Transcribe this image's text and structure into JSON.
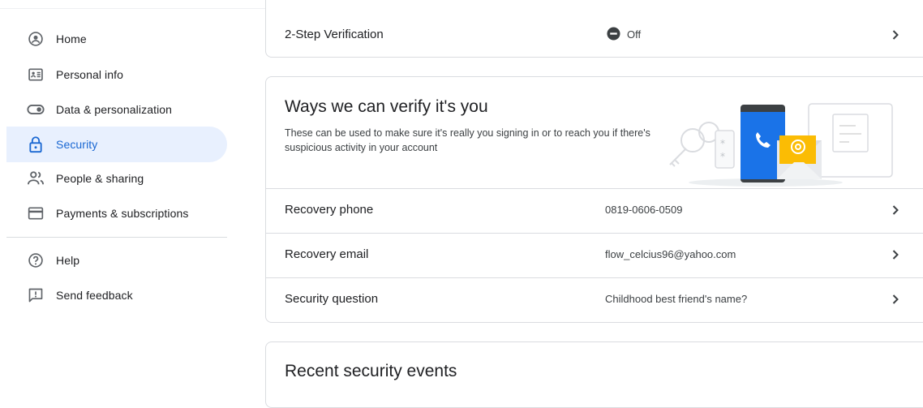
{
  "sidebar": {
    "items": [
      {
        "label": "Home",
        "icon": "account-circle-icon"
      },
      {
        "label": "Personal info",
        "icon": "id-card-icon"
      },
      {
        "label": "Data & personalization",
        "icon": "toggle-icon"
      },
      {
        "label": "Security",
        "icon": "lock-icon",
        "active": true
      },
      {
        "label": "People & sharing",
        "icon": "people-icon"
      },
      {
        "label": "Payments & subscriptions",
        "icon": "credit-card-icon"
      },
      {
        "label": "Help",
        "icon": "help-icon"
      },
      {
        "label": "Send feedback",
        "icon": "feedback-icon"
      }
    ]
  },
  "two_step": {
    "label": "2-Step Verification",
    "status": "Off",
    "status_icon": "minus-circle-icon"
  },
  "verify_card": {
    "title": "Ways we can verify it's you",
    "description": "These can be used to make sure it's really you signing in or to reach you if there's suspicious activity in your account",
    "rows": [
      {
        "label": "Recovery phone",
        "value": "0819-0606-0509"
      },
      {
        "label": "Recovery email",
        "value": "flow_celcius96@yahoo.com"
      },
      {
        "label": "Security question",
        "value": "Childhood best friend's name?"
      }
    ]
  },
  "events_card": {
    "title": "Recent security events"
  },
  "colors": {
    "active_bg": "#e8f0fe",
    "active_text": "#1967d2",
    "border": "#dadce0",
    "illustration_blue": "#1a73e8",
    "illustration_yellow": "#fbbc04"
  }
}
